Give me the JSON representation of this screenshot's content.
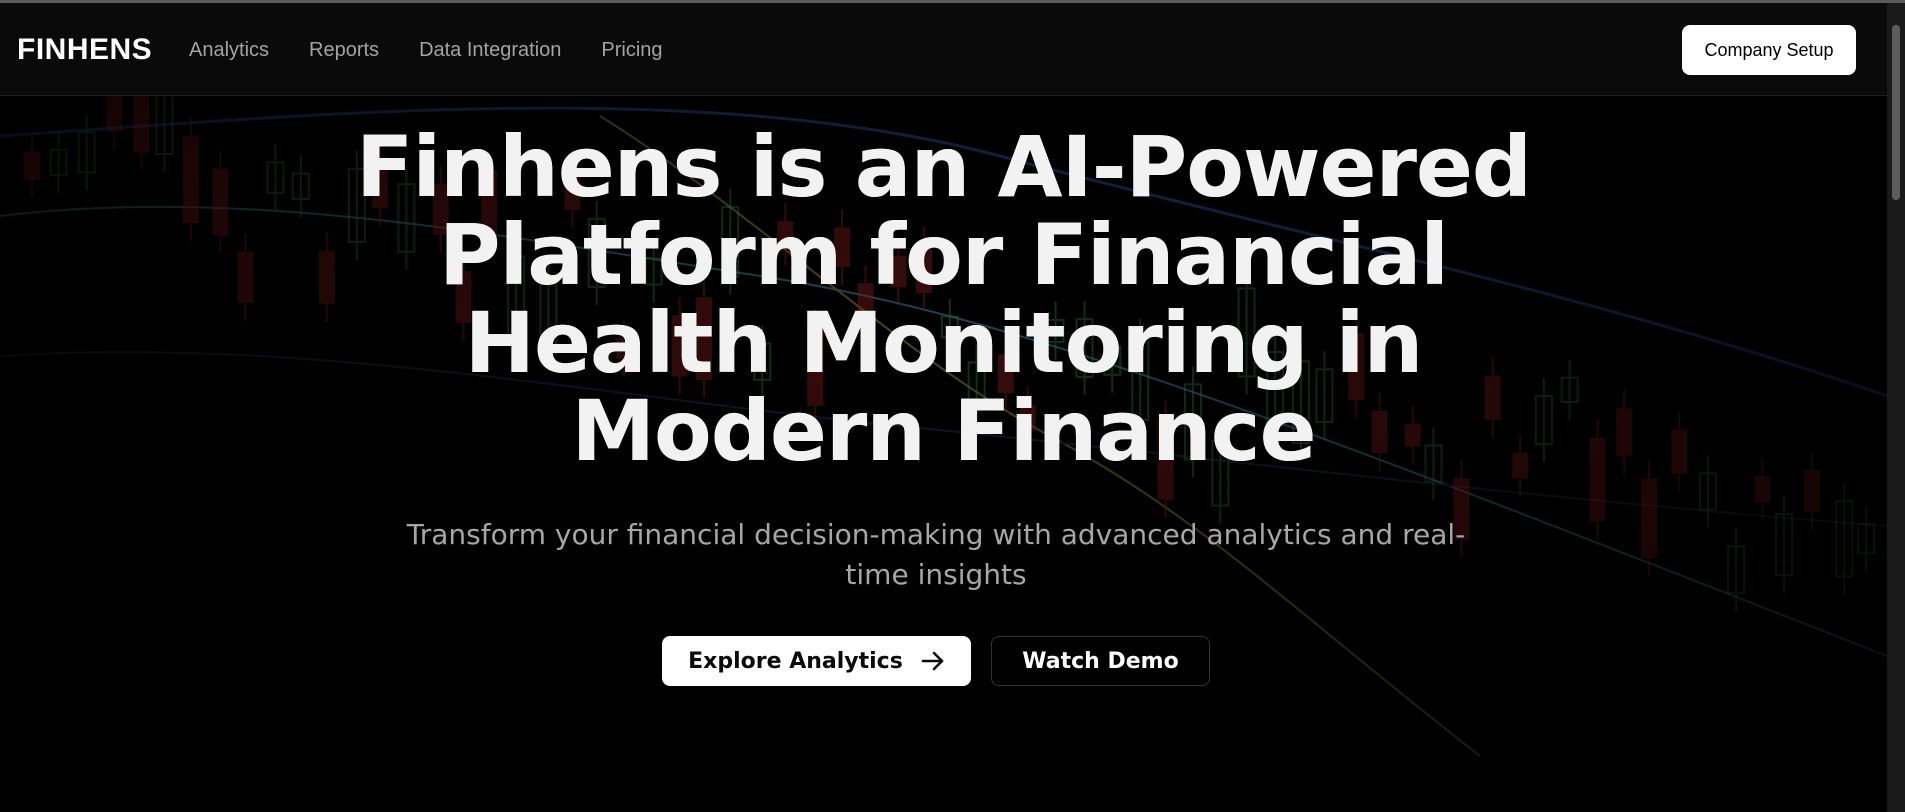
{
  "brand": {
    "name": "FINHENS"
  },
  "nav": {
    "items": [
      {
        "label": "Analytics"
      },
      {
        "label": "Reports"
      },
      {
        "label": "Data Integration"
      },
      {
        "label": "Pricing"
      }
    ]
  },
  "header": {
    "company_setup_label": "Company Setup"
  },
  "hero": {
    "title": "Finhens is an AI-Powered Platform for Financial Health Monitoring in Modern Finance",
    "subtitle": "Transform your financial decision-making with advanced analytics and real-time insights",
    "primary_cta": "Explore Analytics",
    "secondary_cta": "Watch Demo",
    "primary_cta_icon": "arrow-right-icon"
  },
  "background": {
    "icon": "candlestick-chart-background",
    "colors": {
      "bullish": "#3fae5a",
      "bearish": "#c62828",
      "line_blue": "#3b6fd6",
      "line_yellow": "#d8c23a",
      "line_cyan": "#49c2e8"
    }
  },
  "theme": {
    "background": "#000000",
    "header_bg": "#0a0a0a",
    "text_primary": "#ffffff",
    "text_muted": "#a3a3a3"
  }
}
